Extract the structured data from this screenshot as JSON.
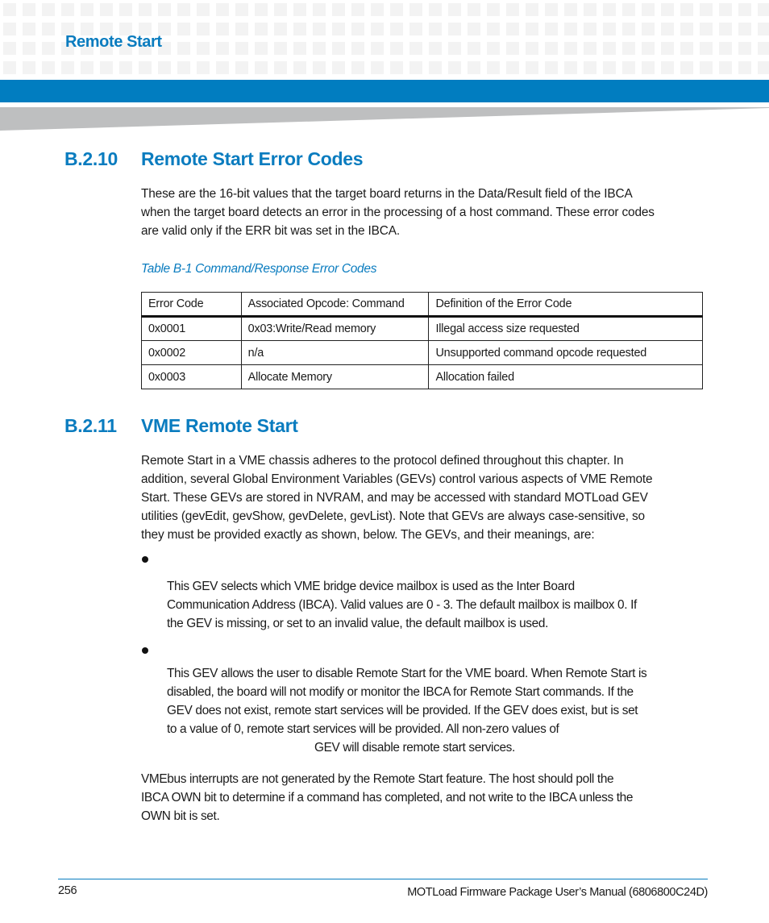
{
  "header": {
    "running_title": "Remote Start",
    "brand_color": "#017dc0",
    "grid_color": "#f3f3f3",
    "wedge_color": "#bebfc0"
  },
  "section_b210": {
    "number": "B.2.10",
    "title": "Remote Start Error Codes",
    "intro_lines": [
      "These are the 16-bit values that the target board returns in the Data/Result field of the IBCA",
      "when the target board detects an error in the processing of a host command. These error codes",
      "are valid only if the ERR bit was set in the IBCA."
    ],
    "table_caption": "Table B-1 Command/Response Error Codes",
    "table": {
      "headers": [
        "Error Code",
        "Associated Opcode: Command",
        "Definition of the Error Code"
      ],
      "rows": [
        [
          "0x0001",
          "0x03:Write/Read memory",
          "Illegal access size requested"
        ],
        [
          "0x0002",
          "n/a",
          "Unsupported command opcode requested"
        ],
        [
          "0x0003",
          "Allocate Memory",
          "Allocation failed"
        ]
      ]
    }
  },
  "section_b211": {
    "number": "B.2.11",
    "title": "VME Remote Start",
    "intro_lines": [
      "Remote Start in a VME chassis adheres to the protocol defined throughout this chapter. In",
      "addition, several Global Environment Variables (GEVs) control various aspects of VME Remote",
      "Start. These GEVs are stored in NVRAM, and may be accessed with standard MOTLoad GEV",
      "utilities (gevEdit, gevShow, gevDelete, gevList). Note that GEVs are always case-sensitive, so",
      "they must be provided exactly as shown, below. The GEVs, and their meanings, are:"
    ],
    "bullets": [
      {
        "lines": [
          "This GEV selects which VME bridge device mailbox is used as the Inter Board",
          "Communication Address (IBCA). Valid values are 0 - 3. The default mailbox is mailbox 0. If",
          "the GEV is missing, or set to an invalid value, the default mailbox is used."
        ]
      },
      {
        "lines": [
          "This GEV allows the user to disable Remote Start for the VME board. When Remote Start is",
          "disabled, the board will not modify or monitor the IBCA for Remote Start commands. If the",
          "GEV does not exist, remote start services will be provided. If the GEV does exist, but is set",
          "to a value of 0, remote start services will be provided. All non-zero values of",
          "GEV will disable remote start services."
        ]
      }
    ],
    "closing_lines": [
      "VMEbus interrupts are not generated by the Remote Start feature. The host should poll the",
      "IBCA OWN bit to determine if a command has completed, and not write to the IBCA unless the",
      "OWN bit is set."
    ]
  },
  "footer": {
    "page_number": "256",
    "document_title": "MOTLoad Firmware Package User’s Manual (6806800C24D)"
  }
}
